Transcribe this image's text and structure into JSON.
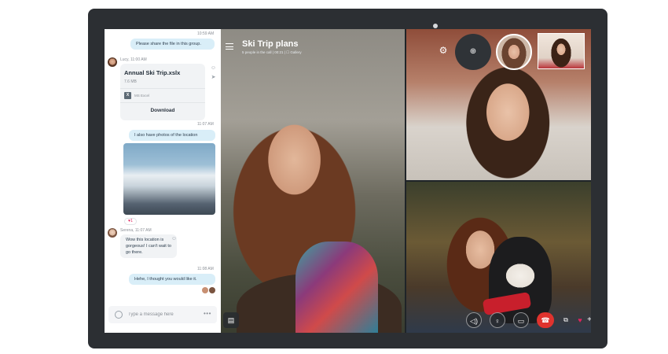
{
  "chat": {
    "messages": [
      {
        "time": "10:59 AM",
        "text": "Please share the file in this group."
      },
      {
        "sender": "Lucy, 11:00 AM"
      },
      {
        "file": {
          "name": "Annual Ski Trip.xslx",
          "size": "7.6 MB",
          "type": "MS Excel",
          "action": "Download"
        }
      },
      {
        "time": "11:07 AM",
        "text": "I also have photos of the location"
      },
      {
        "reaction": "♥1"
      },
      {
        "sender": "Serena, 11:07 AM",
        "text": "Wow this location is gorgeous! I can't wait to go there."
      },
      {
        "time": "11:08 AM",
        "text": "Hehe, I thought you would like it."
      }
    ],
    "composer": {
      "placeholder": "Type a message here",
      "more": "•••"
    }
  },
  "call": {
    "title": "Ski Trip plans",
    "subtitle": "5 people in the call | 00:21 | ☐ Gallery"
  },
  "icons": {
    "gear": "⚙",
    "add_person": "⊕",
    "chat": "▤",
    "volume": "◁)",
    "mic": "♀",
    "camera": "▭",
    "end": "☎",
    "share": "⧉",
    "heart": "♥",
    "plus": "+"
  },
  "colors": {
    "accent": "#00aff0",
    "end_call": "#e0332e",
    "heart": "#e0245e"
  }
}
